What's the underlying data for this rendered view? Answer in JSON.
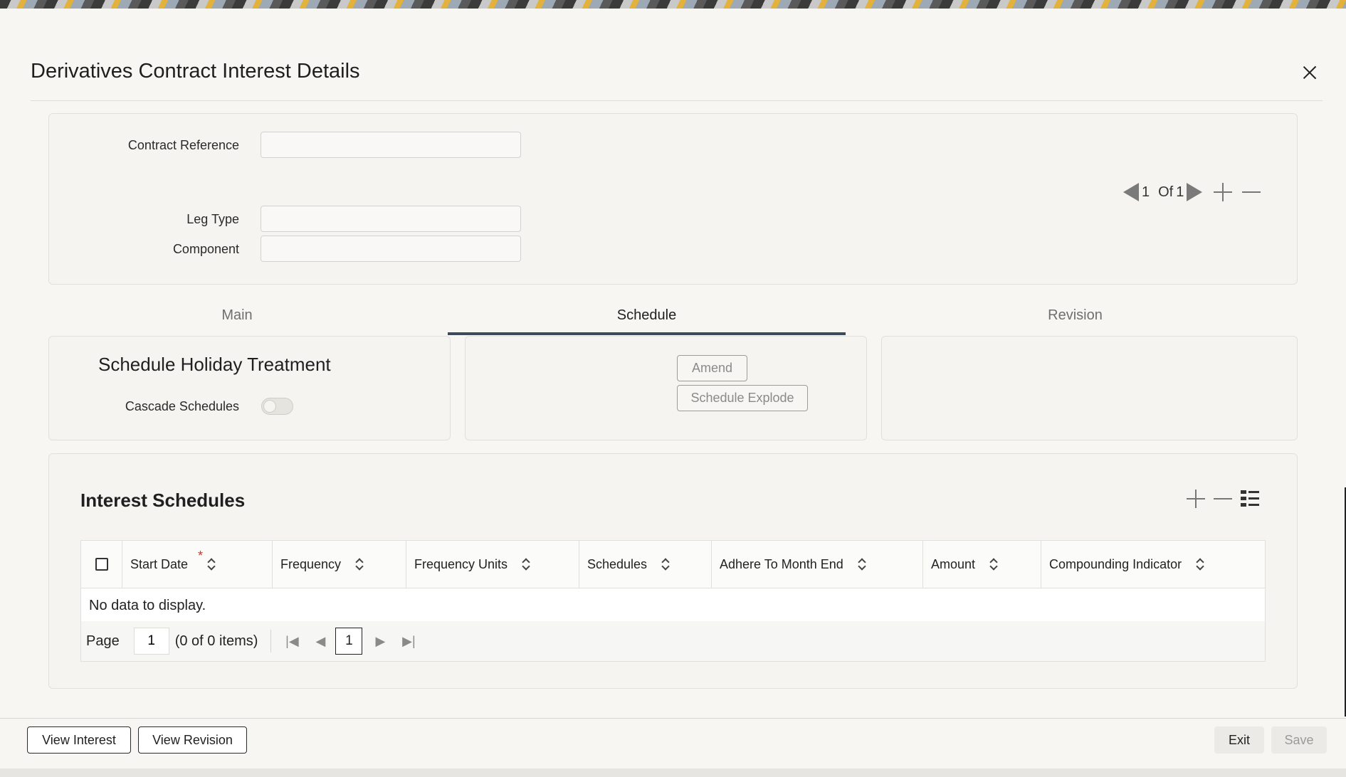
{
  "header": {
    "title": "Derivatives Contract Interest Details"
  },
  "form": {
    "contract_reference": {
      "label": "Contract Reference",
      "value": ""
    },
    "leg_type": {
      "label": "Leg Type",
      "value": ""
    },
    "component": {
      "label": "Component",
      "value": ""
    }
  },
  "record_pager": {
    "current": "1",
    "of_label": "Of",
    "total": "1"
  },
  "tabs": [
    {
      "label": "Main",
      "active": false
    },
    {
      "label": "Schedule",
      "active": true
    },
    {
      "label": "Revision",
      "active": false
    }
  ],
  "holiday": {
    "title": "Schedule Holiday Treatment",
    "cascade_label": "Cascade Schedules",
    "cascade_on": false
  },
  "schedule_actions": {
    "amend": "Amend",
    "explode": "Schedule Explode"
  },
  "grid": {
    "title": "Interest Schedules",
    "columns": [
      {
        "label": "Start Date",
        "required": "*"
      },
      {
        "label": "Frequency"
      },
      {
        "label": "Frequency Units"
      },
      {
        "label": "Schedules"
      },
      {
        "label": "Adhere To Month End"
      },
      {
        "label": "Amount"
      },
      {
        "label": "Compounding Indicator"
      }
    ],
    "empty_text": "No data to display.",
    "footer": {
      "page_label": "Page",
      "page_value": "1",
      "items_text": "(0 of 0 items)",
      "current_page": "1"
    }
  },
  "footer": {
    "view_interest": "View Interest",
    "view_revision": "View Revision",
    "exit": "Exit",
    "save": "Save"
  },
  "colors": {
    "accent": "#3d4a5c",
    "required": "#c0392b"
  }
}
